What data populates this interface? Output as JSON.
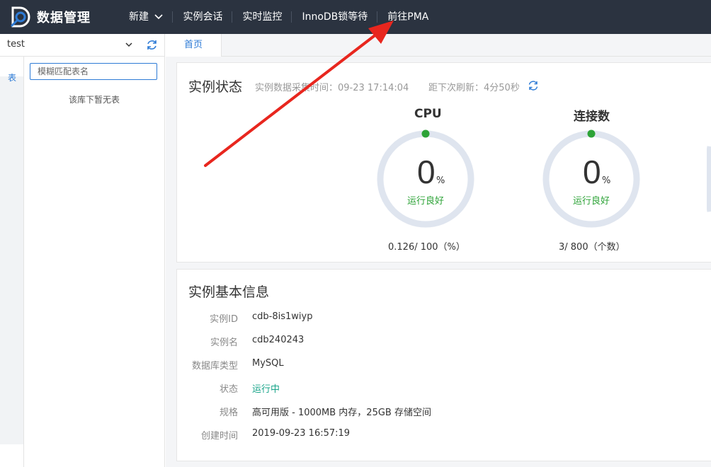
{
  "header": {
    "brand": "数据管理",
    "nav": [
      {
        "label": "新建"
      },
      {
        "label": "实例会话"
      },
      {
        "label": "实时监控"
      },
      {
        "label": "InnoDB锁等待"
      },
      {
        "label": "前往PMA"
      }
    ]
  },
  "sidebar": {
    "database": "test",
    "tab": "表",
    "search_placeholder": "模糊匹配表名",
    "empty_text": "该库下暂无表"
  },
  "tabs": [
    {
      "label": "首页"
    }
  ],
  "status_card": {
    "title": "实例状态",
    "collect_time": "实例数据采集时间：09-23 17:14:04",
    "next_refresh": "距下次刷新：4分50秒",
    "gauges": [
      {
        "title": "CPU",
        "value": "0",
        "unit": "%",
        "status": "运行良好",
        "footer": "0.126/ 100（%）"
      },
      {
        "title": "连接数",
        "value": "0",
        "unit": "%",
        "status": "运行良好",
        "footer": "3/ 800（个数）"
      }
    ]
  },
  "info_card": {
    "title": "实例基本信息",
    "rows": [
      {
        "label": "实例ID",
        "value": "cdb-8is1wiyp"
      },
      {
        "label": "实例名",
        "value": "cdb240243"
      },
      {
        "label": "数据库类型",
        "value": "MySQL"
      },
      {
        "label": "状态",
        "value": "运行中"
      },
      {
        "label": "规格",
        "value": "高可用版 - 1000MB 内存，25GB 存储空间"
      },
      {
        "label": "创建时间",
        "value": "2019-09-23 16:57:19"
      }
    ]
  },
  "colors": {
    "topbar": "#2b3340",
    "accent": "#2d7bd6",
    "good": "#2da337",
    "running": "#1aa58a",
    "arrow": "#e8261e"
  }
}
